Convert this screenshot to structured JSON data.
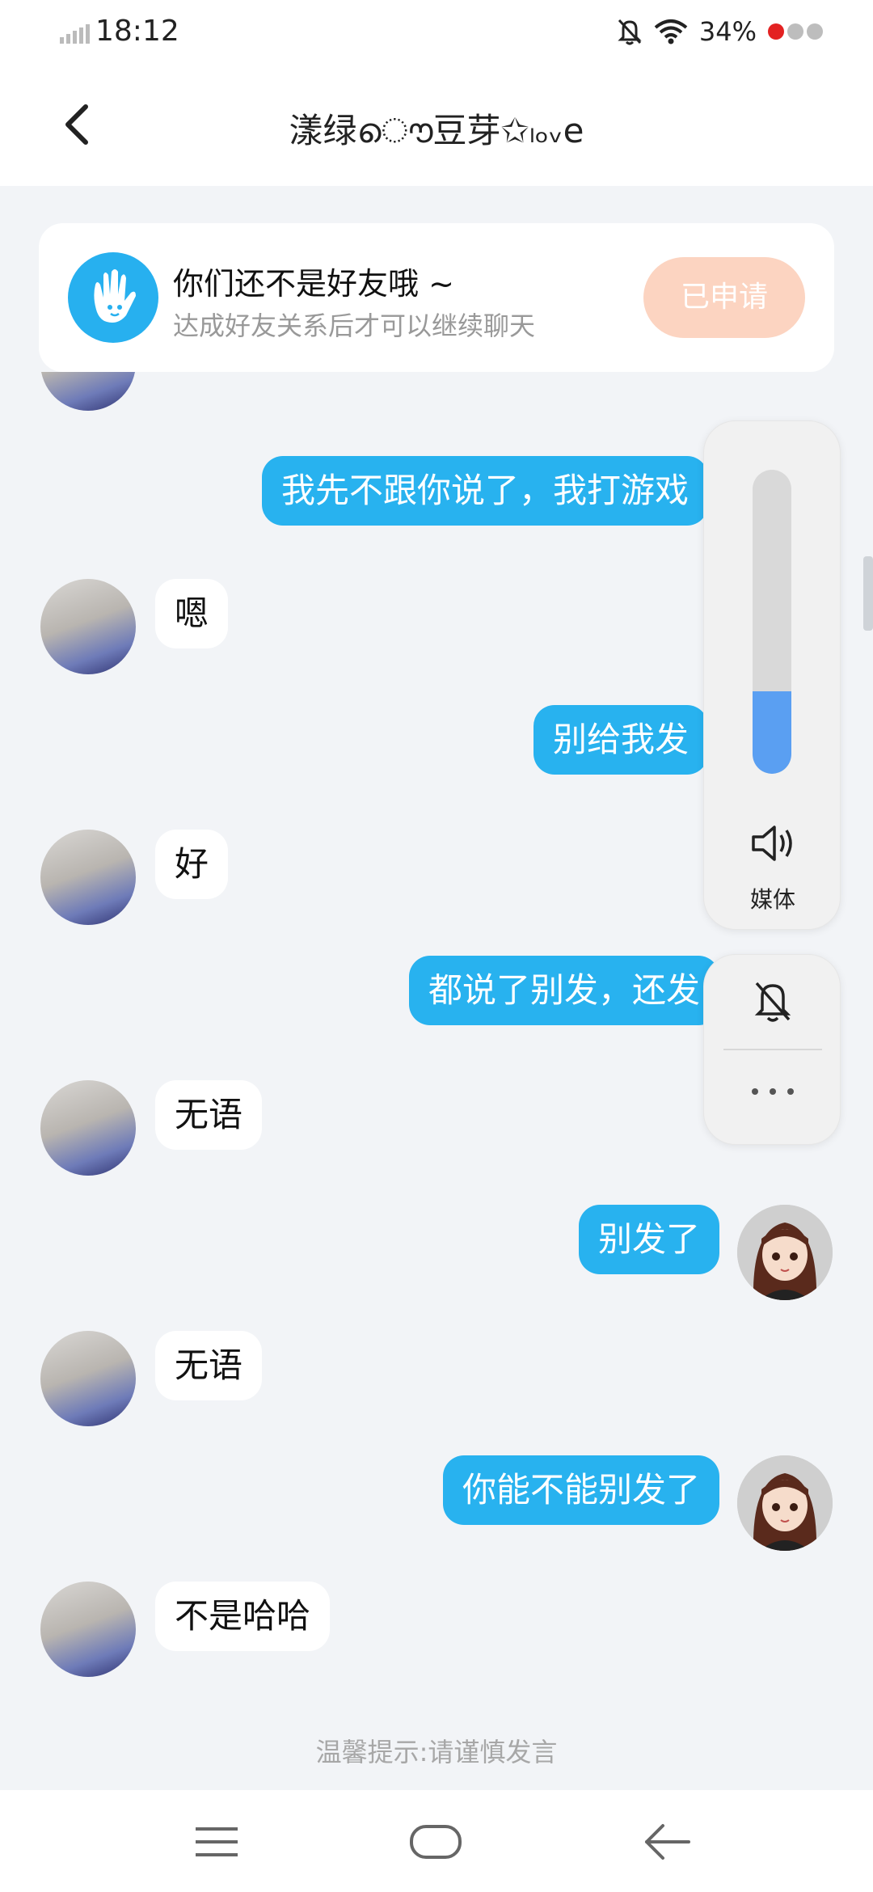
{
  "status_bar": {
    "time": "18:12",
    "battery": "34%"
  },
  "header": {
    "title": "漾绿ൌ豆芽✩ₗₒᵥe"
  },
  "notice": {
    "title": "你们还不是好友哦 ~",
    "subtitle": "达成好友关系后才可以继续聊天",
    "button": "已申请"
  },
  "messages": [
    {
      "from": "me",
      "text": "我先不跟你说了，我打游戏"
    },
    {
      "from": "friend",
      "text": "嗯"
    },
    {
      "from": "me",
      "text": "别给我发"
    },
    {
      "from": "friend",
      "text": "好"
    },
    {
      "from": "me",
      "text": "都说了别发，还发"
    },
    {
      "from": "friend",
      "text": "无语"
    },
    {
      "from": "me",
      "text": "别发了"
    },
    {
      "from": "friend",
      "text": "无语"
    },
    {
      "from": "me",
      "text": "你能不能别发了"
    },
    {
      "from": "friend",
      "text": "不是哈哈"
    }
  ],
  "footer_tip": "温馨提示:请谨慎发言",
  "volume_panel": {
    "label": "媒体",
    "level": 0.27
  },
  "colors": {
    "outgoing_bubble": "#28b2ef",
    "applied_button": "#fcd4c1",
    "volume_fill": "#5a9ff2"
  }
}
